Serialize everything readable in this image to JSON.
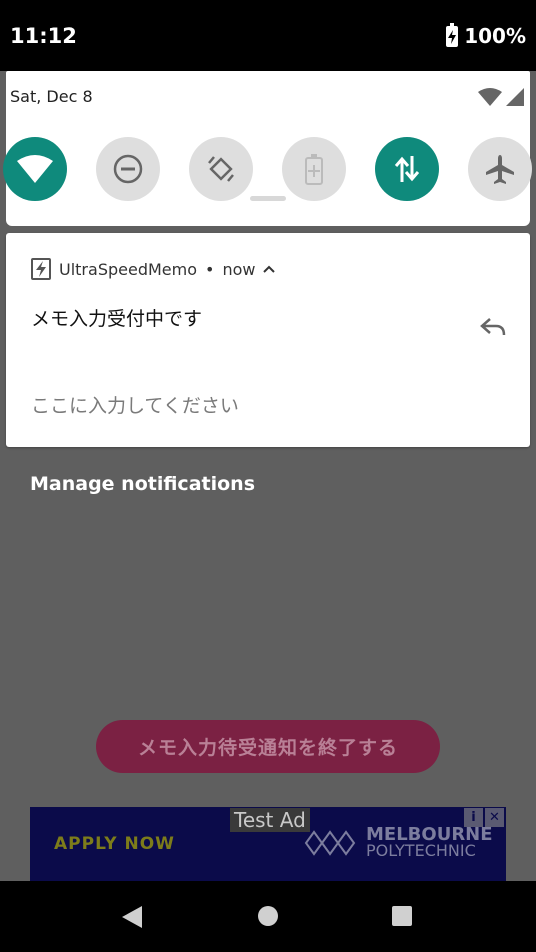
{
  "status_bar": {
    "time": "11:12",
    "battery": "100%"
  },
  "quick_settings": {
    "date": "Sat, Dec 8",
    "tiles": [
      {
        "name": "wifi-icon",
        "state": "on"
      },
      {
        "name": "do-not-disturb-icon",
        "state": "off"
      },
      {
        "name": "auto-rotate-icon",
        "state": "off"
      },
      {
        "name": "battery-saver-icon",
        "state": "off"
      },
      {
        "name": "mobile-data-icon",
        "state": "on"
      },
      {
        "name": "airplane-mode-icon",
        "state": "off"
      }
    ]
  },
  "notification": {
    "app_name": "UltraSpeedMemo",
    "separator": "•",
    "time": "now",
    "title": "メモ入力受付中です",
    "input_placeholder": "ここに入力してください"
  },
  "manage_label": "Manage notifications",
  "app": {
    "end_button_label": "メモ入力待受通知を終了する"
  },
  "ad": {
    "label": "Test Ad",
    "apply": "APPLY NOW",
    "brand_line1": "MELBOURNE",
    "brand_line2": "POLYTECHNIC",
    "info_glyph": "i",
    "close_glyph": "✕"
  },
  "colors": {
    "accent": "#0f8a7c",
    "button": "#7b2143"
  }
}
